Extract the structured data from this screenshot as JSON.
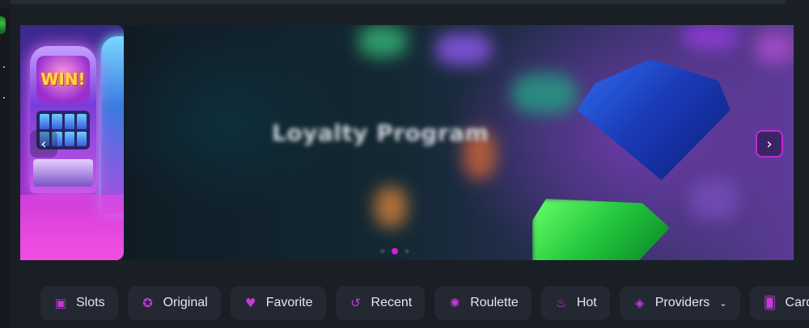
{
  "banner": {
    "title": "Loyalty Program",
    "prev_arrow": "‹",
    "next_arrow": "›",
    "side_card_text": "WIN!",
    "dots_total": 3,
    "dots_active_index": 1
  },
  "categories": [
    {
      "label": "Slots",
      "icon": "slot-machine-icon",
      "glyph": "▣"
    },
    {
      "label": "Original",
      "icon": "chip-icon",
      "glyph": "✪"
    },
    {
      "label": "Favorite",
      "icon": "heart-icon",
      "glyph": "♥"
    },
    {
      "label": "Recent",
      "icon": "history-icon",
      "glyph": "↺"
    },
    {
      "label": "Roulette",
      "icon": "roulette-icon",
      "glyph": "✺"
    },
    {
      "label": "Hot",
      "icon": "flame-icon",
      "glyph": "♨"
    },
    {
      "label": "Providers",
      "icon": "diamond-icon",
      "glyph": "◈",
      "caret": "⌄"
    },
    {
      "label": "Card",
      "icon": "cards-icon",
      "glyph": "🂠"
    }
  ],
  "colors": {
    "accent": "#c23bd8",
    "background": "#1a1f26",
    "chip": "#232832"
  }
}
